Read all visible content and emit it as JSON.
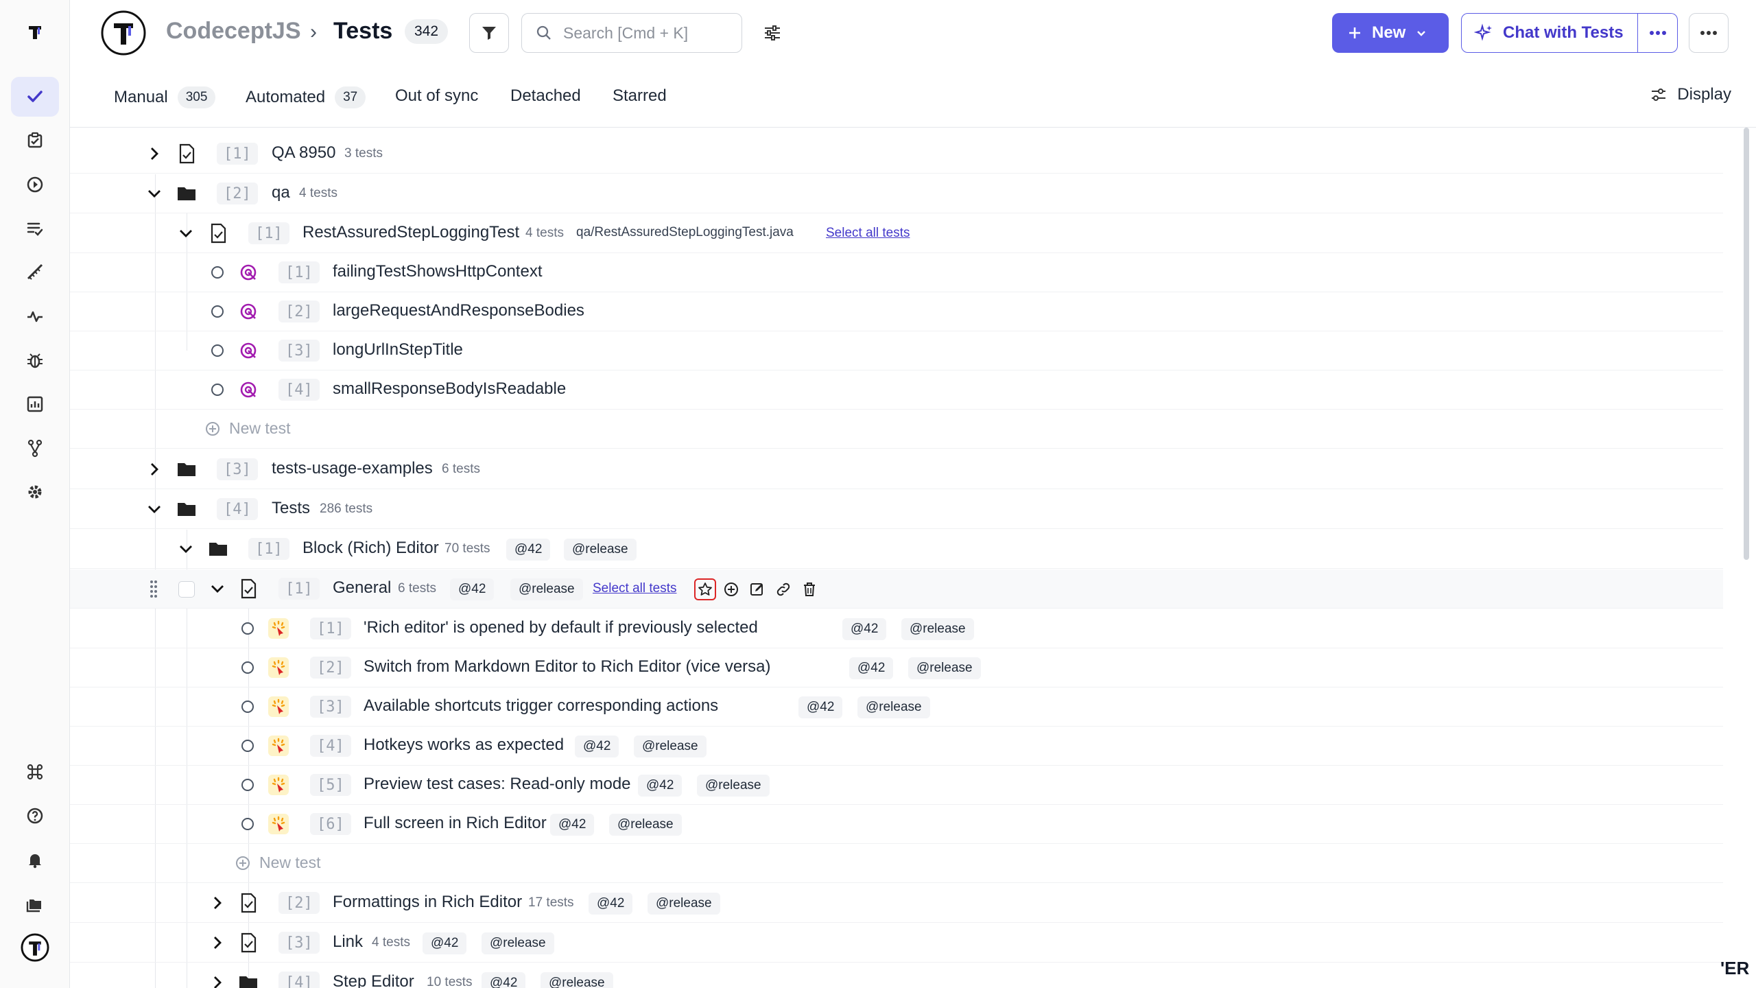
{
  "header": {
    "app": "CodeceptJS",
    "separator": "›",
    "page": "Tests",
    "count": "342",
    "search_placeholder": "Search [Cmd + K]",
    "new_label": "New",
    "chat_label": "Chat with Tests"
  },
  "tabs": [
    {
      "label": "Manual",
      "count": "305"
    },
    {
      "label": "Automated",
      "count": "37"
    },
    {
      "label": "Out of sync",
      "count": ""
    },
    {
      "label": "Detached",
      "count": ""
    },
    {
      "label": "Starred",
      "count": ""
    }
  ],
  "display_label": "Display",
  "tree": {
    "qa8950": {
      "num": "[1]",
      "title": "QA 8950",
      "meta": "3 tests"
    },
    "qa": {
      "num": "[2]",
      "title": "qa",
      "meta": "4 tests"
    },
    "rest": {
      "num": "[1]",
      "title": "RestAssuredStepLoggingTest",
      "meta": "4 tests",
      "path": "qa/RestAssuredStepLoggingTest.java",
      "select_all": "Select all tests"
    },
    "rest_tests": [
      {
        "num": "[1]",
        "title": "failingTestShowsHttpContext"
      },
      {
        "num": "[2]",
        "title": "largeRequestAndResponseBodies"
      },
      {
        "num": "[3]",
        "title": "longUrlInStepTitle"
      },
      {
        "num": "[4]",
        "title": "smallResponseBodyIsReadable"
      }
    ],
    "new_test": "New test",
    "usage": {
      "num": "[3]",
      "title": "tests-usage-examples",
      "meta": "6 tests"
    },
    "tests": {
      "num": "[4]",
      "title": "Tests",
      "meta": "286 tests"
    },
    "block": {
      "num": "[1]",
      "title": "Block (Rich) Editor",
      "meta": "70 tests",
      "tag1": "@42",
      "tag2": "@release"
    },
    "general": {
      "num": "[1]",
      "title": "General",
      "meta": "6 tests",
      "tag1": "@42",
      "tag2": "@release",
      "select_all": "Select all tests"
    },
    "general_tests": [
      {
        "num": "[1]",
        "title": "'Rich editor' is opened by default if previously selected",
        "tag1": "@42",
        "tag2": "@release"
      },
      {
        "num": "[2]",
        "title": "Switch from Markdown Editor to Rich Editor (vice versa)",
        "tag1": "@42",
        "tag2": "@release"
      },
      {
        "num": "[3]",
        "title": "Available shortcuts trigger corresponding actions",
        "tag1": "@42",
        "tag2": "@release"
      },
      {
        "num": "[4]",
        "title": "Hotkeys works as expected",
        "tag1": "@42",
        "tag2": "@release"
      },
      {
        "num": "[5]",
        "title": "Preview test cases: Read-only mode",
        "tag1": "@42",
        "tag2": "@release"
      },
      {
        "num": "[6]",
        "title": "Full screen in Rich Editor",
        "tag1": "@42",
        "tag2": "@release"
      }
    ],
    "formatting": {
      "num": "[2]",
      "title": "Formattings in Rich Editor",
      "meta": "17 tests",
      "tag1": "@42",
      "tag2": "@release"
    },
    "link": {
      "num": "[3]",
      "title": "Link",
      "meta": "4 tests",
      "tag1": "@42",
      "tag2": "@release"
    },
    "step": {
      "num": "[4]",
      "title": "Step Editor",
      "meta": "10 tests",
      "tag1": "@42",
      "tag2": "@release"
    }
  },
  "corner_text": "'ER",
  "colors": {
    "accent": "#5b5ce6",
    "automated": "#a21caf",
    "manual": "#f59e0b",
    "highlight_box": "#dc2626"
  }
}
